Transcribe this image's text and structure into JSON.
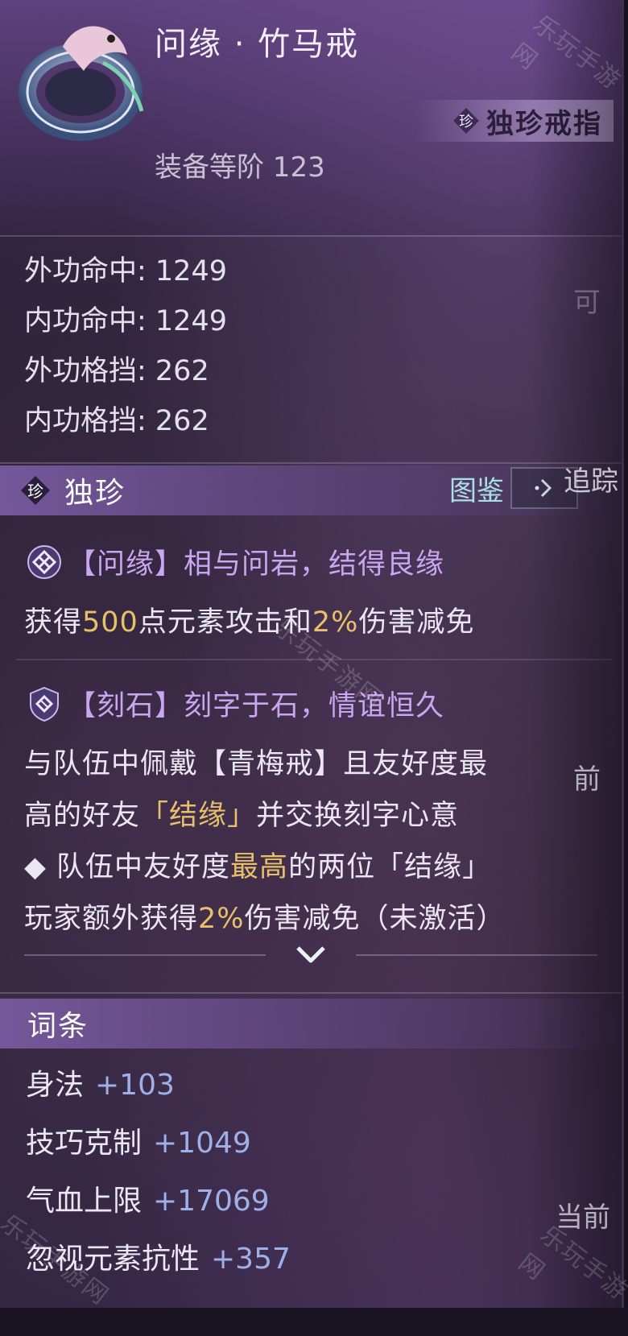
{
  "item": {
    "name": "问缘 · 竹马戒",
    "rarity_label": "独珍戒指",
    "rarity_gem": "珍",
    "equip_level": "装备等阶 123"
  },
  "stats": [
    "外功命中: 1249",
    "内功命中: 1249",
    "外功格挡: 262",
    "内功格挡: 262"
  ],
  "unique_section": {
    "gem": "珍",
    "title": "独珍",
    "atlas_label": "图鉴"
  },
  "effect1": {
    "icon": "diamond-knot-icon",
    "title": "【问缘】相与问岩，结得良缘",
    "line": {
      "a": "获得",
      "b": "500",
      "c": "点元素攻击和",
      "d": "2%",
      "e": "伤害减免"
    }
  },
  "effect2": {
    "icon": "shield-icon",
    "title": "【刻石】刻字于石，情谊恒久",
    "line1": "与队伍中佩戴【青梅戒】且友好度最",
    "line2": {
      "a": "高的好友",
      "b": "「结缘」",
      "c": "并交换刻字心意"
    },
    "line3": {
      "a": "◆ 队伍中友好度",
      "b": "最高",
      "c": "的两位「结缘」"
    },
    "line4": {
      "a": "玩家额外获得",
      "b": "2%",
      "c": "伤害减免（未激活）"
    }
  },
  "affix_section": {
    "title": "词条"
  },
  "affixes": [
    {
      "name": "身法",
      "value": "+103"
    },
    {
      "name": "技巧克制",
      "value": "+1049"
    },
    {
      "name": "气血上限",
      "value": "+17069"
    },
    {
      "name": "忽视元素抗性",
      "value": "+357"
    }
  ],
  "right_panel": {
    "partial_1": "可",
    "partial_2": "追踪",
    "partial_3": "前",
    "partial_4": "当前"
  },
  "watermark": "乐玩手游网",
  "colors": {
    "gold": "#e6c06a",
    "affix_value": "#9fb0e8",
    "effect_title": "#c9a6f0"
  }
}
